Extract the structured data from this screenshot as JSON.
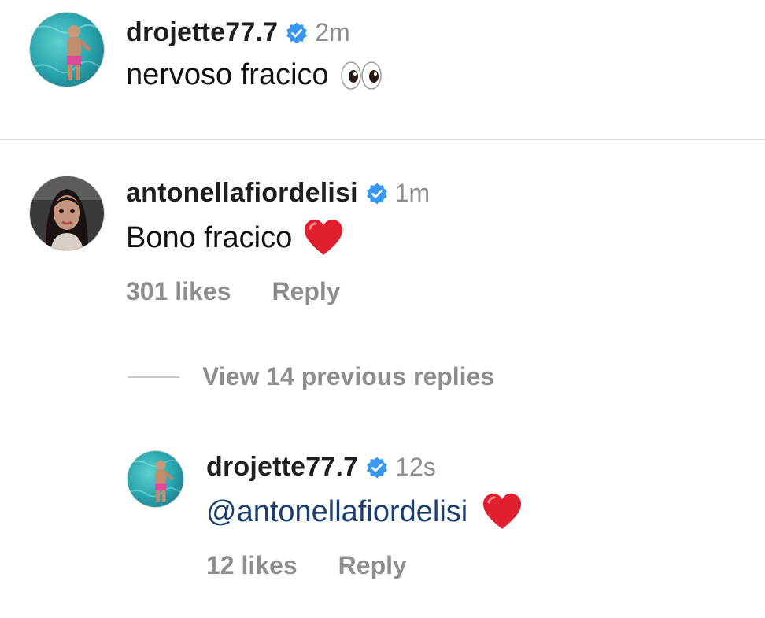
{
  "comments": [
    {
      "username": "drojette77.7",
      "timestamp": "2m",
      "text": "nervoso fracico",
      "emoji": "eyes-emoji"
    },
    {
      "username": "antonellafiordelisi",
      "timestamp": "1m",
      "text": "Bono fracico",
      "emoji": "red-heart-emoji",
      "likes": "301 likes",
      "reply_label": "Reply"
    }
  ],
  "view_replies_label": "View 14 previous replies",
  "reply": {
    "username": "drojette77.7",
    "timestamp": "12s",
    "mention": "@antonellafiordelisi",
    "emoji": "red-heart-emoji",
    "likes": "12 likes",
    "reply_label": "Reply"
  },
  "colors": {
    "verified_badge": "#3897f0",
    "mention": "#1c3f73",
    "muted_text": "#8e8e8e",
    "divider": "#dbdbdb"
  }
}
